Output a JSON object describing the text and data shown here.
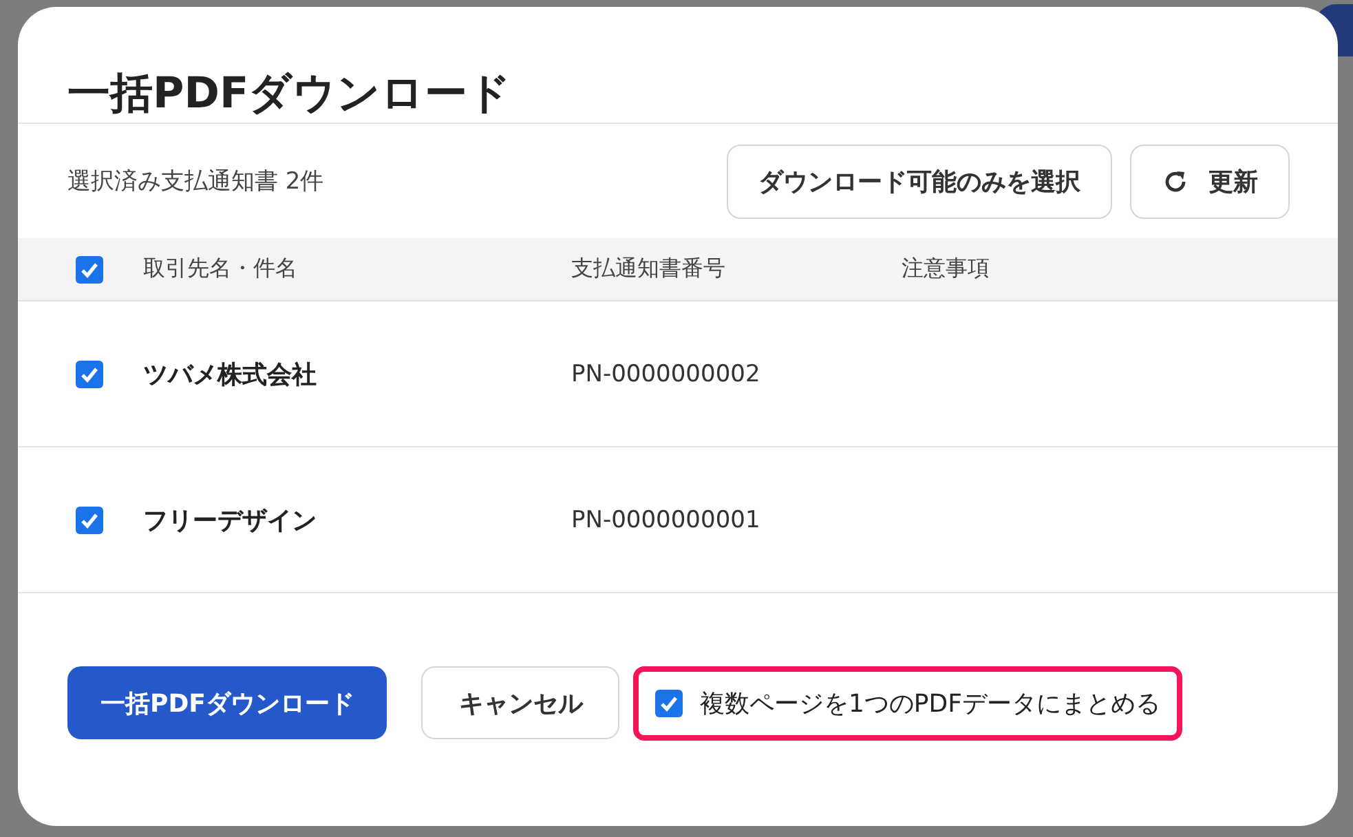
{
  "dialog": {
    "title": "一括PDFダウンロード"
  },
  "toolbar": {
    "selection_count": "選択済み支払通知書 2件",
    "buttons": [
      {
        "label": "ダウンロード可能のみを選択",
        "kind": "text"
      },
      {
        "label": "更新",
        "kind": "refresh"
      }
    ]
  },
  "table": {
    "select_all": {
      "checked": true
    },
    "columns": [
      "取引先名・件名",
      "支払通知書番号",
      "注意事項"
    ],
    "rows": [
      {
        "checked": true,
        "name": "ツバメ株式会社",
        "number": "PN-0000000002"
      },
      {
        "checked": true,
        "name": "フリーデザイン",
        "number": "PN-0000000001"
      }
    ]
  },
  "footer": {
    "primary_button": "一括PDFダウンロード",
    "cancel_button": "キャンセル",
    "merge_option": {
      "label": "複数ページを1つのPDFデータにまとめる",
      "checked": true,
      "highlighted": true
    }
  }
}
